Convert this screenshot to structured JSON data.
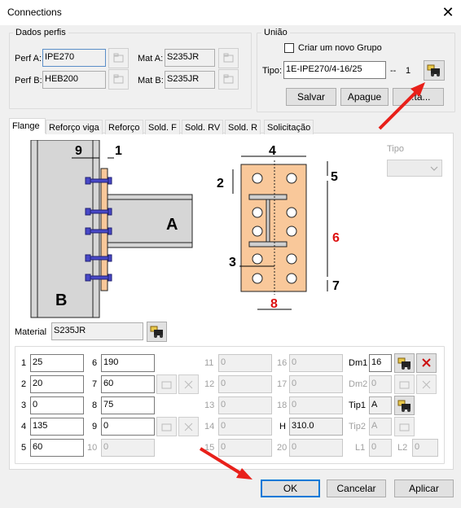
{
  "window": {
    "title": "Connections",
    "close_glyph": "✕"
  },
  "profiles": {
    "group_label": "Dados perfis",
    "perf_a_label": "Perf A:",
    "perf_a_value": "IPE270",
    "perf_b_label": "Perf B:",
    "perf_b_value": "HEB200",
    "mat_a_label": "Mat A:",
    "mat_a_value": "S235JR",
    "mat_b_label": "Mat B:",
    "mat_b_value": "S235JR"
  },
  "union": {
    "group_label": "União",
    "new_group_label": "Criar um novo Grupo",
    "tipo_label": "Tipo:",
    "tipo_value": "1E-IPE270/4-16/25",
    "separator": "--",
    "count": "1",
    "save_label": "Salvar",
    "delete_label": "Apague",
    "more_label": "...ta..."
  },
  "tabs": [
    "Flange",
    "Reforço viga",
    "Reforço",
    "Sold. F",
    "Sold. RV",
    "Sold. R",
    "Solicitação"
  ],
  "diagram": {
    "labels": [
      "9",
      "1",
      "A",
      "B",
      "4",
      "2",
      "5",
      "6",
      "3",
      "7",
      "8"
    ]
  },
  "tipo_side_label": "Tipo",
  "material": {
    "label": "Material",
    "value": "S235JR"
  },
  "params": {
    "col1": [
      {
        "n": "1",
        "v": "25"
      },
      {
        "n": "2",
        "v": "20"
      },
      {
        "n": "3",
        "v": "0"
      },
      {
        "n": "4",
        "v": "135"
      },
      {
        "n": "5",
        "v": "60"
      }
    ],
    "col2": [
      {
        "n": "6",
        "v": "190"
      },
      {
        "n": "7",
        "v": "60"
      },
      {
        "n": "8",
        "v": "75"
      },
      {
        "n": "9",
        "v": "0"
      },
      {
        "n": "10",
        "v": "0"
      }
    ],
    "col3": [
      {
        "n": "11",
        "v": "0"
      },
      {
        "n": "12",
        "v": "0"
      },
      {
        "n": "13",
        "v": "0"
      },
      {
        "n": "14",
        "v": "0"
      },
      {
        "n": "15",
        "v": "0"
      }
    ],
    "col4": [
      {
        "n": "16",
        "v": "0"
      },
      {
        "n": "17",
        "v": "0"
      },
      {
        "n": "18",
        "v": "0"
      },
      {
        "n": "H",
        "v": "310.0"
      },
      {
        "n": "20",
        "v": "0"
      }
    ],
    "dm1_label": "Dm1",
    "dm1_value": "16",
    "dm2_label": "Dm2",
    "dm2_value": "0",
    "tip1_label": "Tip1",
    "tip1_value": "A",
    "tip2_label": "Tip2",
    "tip2_value": "A",
    "l1_label": "L1",
    "l1_value": "0",
    "l2_label": "L2",
    "l2_value": "0"
  },
  "footer": {
    "ok_label": "OK",
    "cancel_label": "Cancelar",
    "apply_label": "Aplicar"
  },
  "colors": {
    "plate": "#f9c89a",
    "arrow": "#e8201a",
    "bolt": "#4848c8",
    "red_label": "#dd1111"
  }
}
